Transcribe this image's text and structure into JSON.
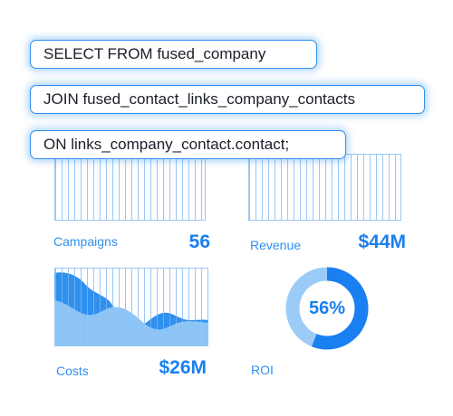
{
  "query": {
    "select": "SELECT FROM fused_company",
    "join": "JOIN fused_contact_links_company_contacts",
    "on": "ON links_company_contact.contact;"
  },
  "metrics": {
    "campaigns": {
      "label": "Campaigns",
      "value": "56"
    },
    "revenue": {
      "label": "Revenue",
      "value": "$44M"
    },
    "costs": {
      "label": "Costs",
      "value": "$26M"
    },
    "roi": {
      "label": "ROI",
      "value": "56%",
      "fraction": 0.56
    }
  },
  "colors": {
    "accent": "#1a7ff0",
    "accent_light": "#9cc7f4",
    "donut_track": "#9ccbf7",
    "area_dark": "#2f90ee",
    "area_light": "#8cc4f5"
  }
}
